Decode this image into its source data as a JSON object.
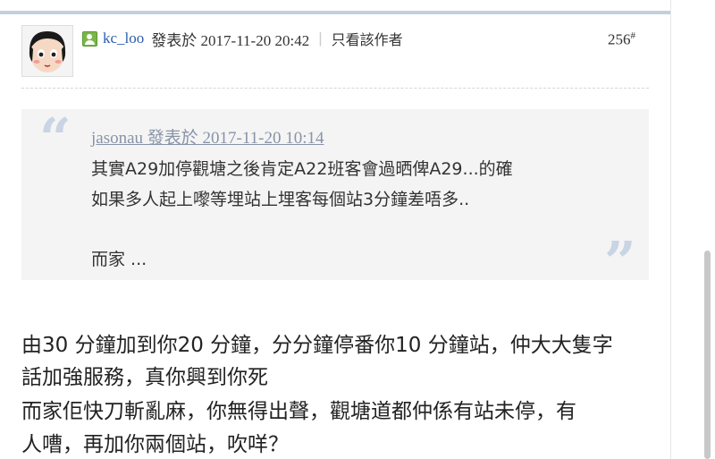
{
  "post": {
    "username": "kc_loo",
    "posted_label": "發表於 2017-11-20 20:42",
    "separator": "|",
    "only_author": "只看該作者",
    "floor_number": "256",
    "floor_mark": "#",
    "online_icon": "online-user-icon"
  },
  "quote": {
    "header": "jasonau 發表於 2017-11-20 10:14",
    "lines": [
      "其實A29加停觀塘之後肯定A22班客會過晒俾A29...的確",
      "如果多人起上嚟等埋站上埋客每個站3分鐘差唔多..",
      "而家 ..."
    ],
    "open_mark": "“",
    "close_mark": "”"
  },
  "body": {
    "lines": [
      "由30 分鐘加到你20 分鐘，分分鐘停番你10 分鐘站，仲大大隻字",
      "話加強服務，真你興到你死",
      "而家佢快刀斬亂麻，你無得出聲，觀塘道都仲係有站未停，有",
      "人嘈，再加你兩個站，吹咩？"
    ]
  },
  "colors": {
    "link": "#2a5db0",
    "quote_bg": "#f4f4f4",
    "quote_marks": "#c9d4e4",
    "top_bar": "#c5cfdb"
  }
}
